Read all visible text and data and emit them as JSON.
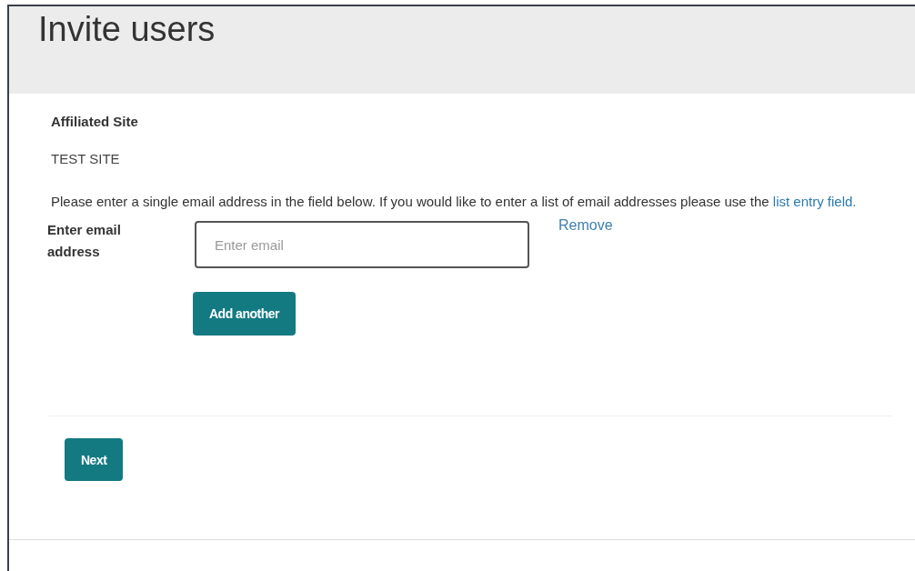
{
  "header": {
    "title": "Invite users"
  },
  "affiliated_site": {
    "label": "Affiliated Site",
    "value": "TEST SITE"
  },
  "instructions": {
    "text": "Please enter a single email address in the field below. If you would like to enter a list of email addresses please use the ",
    "link": "list entry field."
  },
  "email_rows": [
    {
      "label": "Enter email address",
      "placeholder": "Enter email",
      "remove": "Remove"
    }
  ],
  "add_button": "Add another",
  "next_button": "Next"
}
